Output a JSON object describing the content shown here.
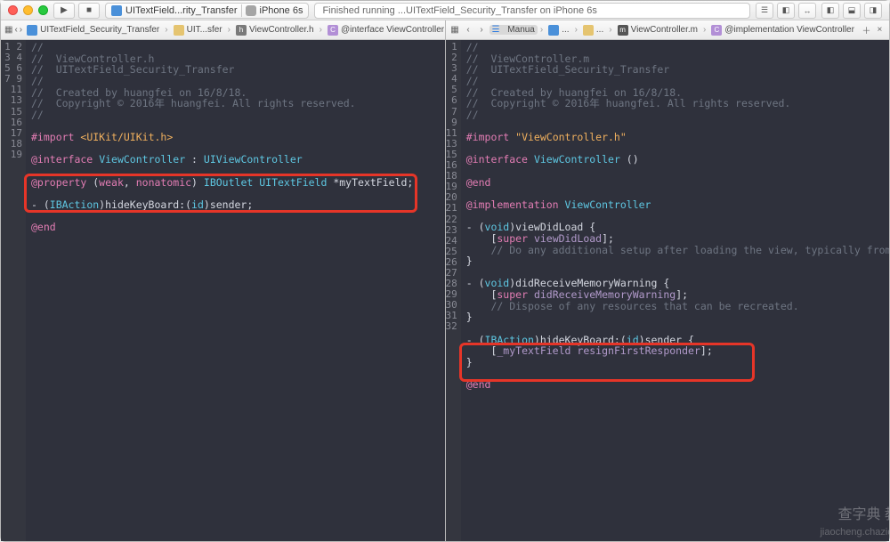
{
  "titlebar": {
    "scheme_name": "UITextField...rity_Transfer",
    "device_name": "iPhone 6s",
    "status": "Finished running ...UITextField_Security_Transfer on iPhone 6s"
  },
  "left": {
    "jumpbar": {
      "file": "UITextField_Security_Transfer",
      "folder": "UIT...sfer",
      "header": "ViewController.h",
      "symbol": "@interface ViewController"
    },
    "gutter": [
      "1",
      "2",
      "3",
      "4",
      "5",
      "6",
      "7",
      "",
      "9",
      "",
      "11",
      "",
      "13",
      "",
      "15",
      "",
      "16",
      "17",
      "18",
      "19"
    ],
    "code_lines": {
      "c0": "//",
      "c1": "//  ViewController.h",
      "c2": "//  UITextField_Security_Transfer",
      "c3": "//",
      "c4": "//  Created by huangfei on 16/8/18.",
      "c5": "//  Copyright © 2016年 huangfei. All rights reserved.",
      "c6": "//",
      "import_kw": "#import",
      "import_val": "<UIKit/UIKit.h>",
      "iface_kw": "@interface",
      "iface_name": "ViewController",
      "iface_sup": "UIViewController",
      "prop": "@property (weak, nonatomic) IBOutlet UITextField *myTextField;",
      "act": "- (IBAction)hideKeyBoard:(id)sender;",
      "end": "@end"
    }
  },
  "right": {
    "jumpbar": {
      "mode": "Manua",
      "folder1": "...",
      "folder2": "...",
      "file": "ViewController.m",
      "symbol": "@implementation ViewController"
    },
    "gutter": [
      "1",
      "2",
      "3",
      "4",
      "5",
      "6",
      "7",
      "",
      "9",
      "",
      "11",
      "",
      "13",
      "",
      "15",
      "16",
      "",
      "18",
      "19",
      "20",
      "21",
      "22",
      "23",
      "24",
      "25",
      "26",
      "27",
      "28",
      "29",
      "30",
      "31",
      "32",
      ""
    ],
    "code_lines": {
      "c0": "//",
      "c1": "//  ViewController.m",
      "c2": "//  UITextField_Security_Transfer",
      "c3": "//",
      "c4": "//  Created by huangfei on 16/8/18.",
      "c5": "//  Copyright © 2016年 huangfei. All rights reserved.",
      "c6": "//",
      "import_kw": "#import",
      "import_val": "\"ViewController.h\"",
      "iface_kw": "@interface",
      "iface_name": "ViewController",
      "iface_tail": " ()",
      "end1": "@end",
      "impl_kw": "@implementation",
      "impl_name": "ViewController",
      "m1a": "- (void)viewDidLoad {",
      "m1b": "    [super viewDidLoad];",
      "m1c": "    // Do any additional setup after loading the view, typically from a nib.",
      "m1d": "}",
      "m2a": "- (void)didReceiveMemoryWarning {",
      "m2b": "    [super didReceiveMemoryWarning];",
      "m2c": "    // Dispose of any resources that can be recreated.",
      "m2d": "}",
      "m3a": "- (IBAction)hideKeyBoard:(id)sender {",
      "m3b": "    [_myTextField resignFirstResponder];",
      "m3c": "}",
      "end2": "@end"
    }
  },
  "watermark": {
    "main": "查字典 教程网",
    "sub": "jiaocheng.chazidian.com"
  }
}
